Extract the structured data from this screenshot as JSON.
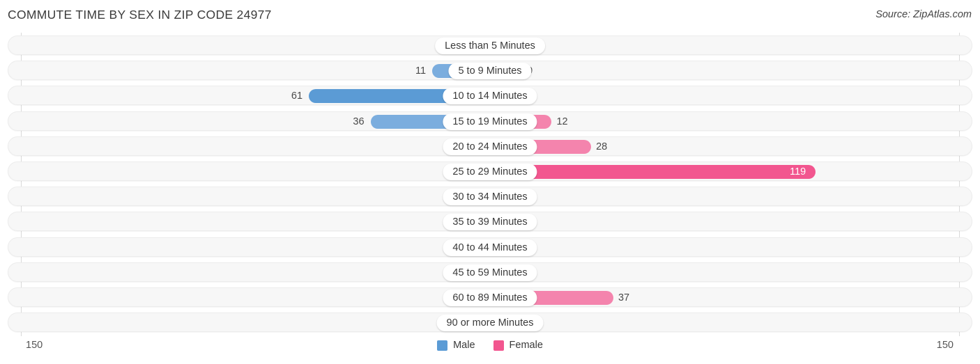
{
  "header": {
    "title": "COMMUTE TIME BY SEX IN ZIP CODE 24977",
    "source": "Source: ZipAtlas.com"
  },
  "legend": {
    "items": [
      {
        "label": "Male",
        "color": "#5b9bd5"
      },
      {
        "label": "Female",
        "color": "#f2568f"
      }
    ]
  },
  "axis": {
    "left_end_label": "150",
    "right_end_label": "150",
    "max": 150
  },
  "colors": {
    "male_strong": "#5b9bd5",
    "male_mid": "#7badde",
    "male_light": "#a8c8e8",
    "female_strong": "#f2568f",
    "female_mid": "#f484ad",
    "female_light": "#f9b4cc",
    "row_track": "#f7f7f7",
    "row_border": "#ececec"
  },
  "chart_data": {
    "type": "bar",
    "orientation": "horizontal-diverging",
    "title": "COMMUTE TIME BY SEX IN ZIP CODE 24977",
    "xlabel": "",
    "ylabel": "",
    "xlim": [
      150,
      150
    ],
    "grid": false,
    "legend_position": "bottom-center",
    "categories": [
      "Less than 5 Minutes",
      "5 to 9 Minutes",
      "10 to 14 Minutes",
      "15 to 19 Minutes",
      "20 to 24 Minutes",
      "25 to 29 Minutes",
      "30 to 34 Minutes",
      "35 to 39 Minutes",
      "40 to 44 Minutes",
      "45 to 59 Minutes",
      "60 to 89 Minutes",
      "90 or more Minutes"
    ],
    "series": [
      {
        "name": "Male",
        "side": "left",
        "values": [
          0,
          11,
          61,
          36,
          0,
          0,
          0,
          0,
          0,
          0,
          0,
          0
        ],
        "labels": [
          "0",
          "11",
          "61",
          "36",
          "0",
          "0",
          "0",
          "0",
          "0",
          "0",
          "0",
          "0"
        ]
      },
      {
        "name": "Female",
        "side": "right",
        "values": [
          0,
          0,
          0,
          12,
          28,
          119,
          0,
          0,
          0,
          0,
          37,
          0
        ],
        "labels": [
          "0",
          "0",
          "0",
          "12",
          "28",
          "119",
          "0",
          "0",
          "0",
          "0",
          "37",
          "0"
        ]
      }
    ]
  }
}
